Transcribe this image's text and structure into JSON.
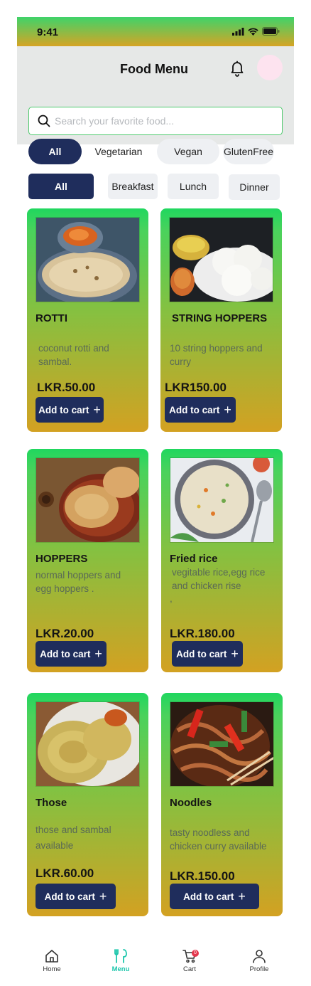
{
  "status": {
    "time": "9:41"
  },
  "header": {
    "title": "Food Menu"
  },
  "search": {
    "placeholder": "Search your favorite food..."
  },
  "diet_filters": [
    {
      "label": "All",
      "active": true
    },
    {
      "label": "Vegetarian",
      "active": false
    },
    {
      "label": "Vegan",
      "active": false
    },
    {
      "label": "GlutenFree",
      "active": false
    }
  ],
  "meal_filters": [
    {
      "label": "All",
      "active": true
    },
    {
      "label": "Breakfast",
      "active": false
    },
    {
      "label": "Lunch",
      "active": false
    },
    {
      "label": "Dinner",
      "active": false
    }
  ],
  "items": [
    {
      "name": "ROTTI",
      "description": "coconut rotti and sambal.",
      "price": "LKR.50.00",
      "button": "Add to cart",
      "image": "rotti-photo"
    },
    {
      "name": "STRING HOPPERS",
      "description": "10 string hoppers and curry",
      "price": "LKR150.00",
      "button": "Add to cart",
      "image": "string-hoppers-photo"
    },
    {
      "name": "HOPPERS",
      "description": "normal hoppers and egg hoppers .",
      "price": "LKR.20.00",
      "button": "Add to cart",
      "image": "hoppers-photo"
    },
    {
      "name": "Fried rice",
      "description": "vegitable rice,egg rice and chicken rise",
      "description_extra": ",",
      "price": "LKR.180.00",
      "button": "Add to cart",
      "image": "fried-rice-photo"
    },
    {
      "name": "Those",
      "description": "those and sambal available",
      "price": "LKR.60.00",
      "button": "Add to cart",
      "image": "thosai-photo"
    },
    {
      "name": "Noodles",
      "description_extra": ".",
      "description": "tasty noodless and chicken curry available",
      "price": "LKR.150.00",
      "button": "Add to cart",
      "image": "noodles-photo"
    }
  ],
  "bottom_nav": [
    {
      "label": "Home",
      "icon": "home-icon"
    },
    {
      "label": "Menu",
      "icon": "menu-icon",
      "active": true
    },
    {
      "label": "Cart",
      "icon": "cart-icon",
      "badge": "0"
    },
    {
      "label": "Profile",
      "icon": "profile-icon"
    }
  ],
  "colors": {
    "primary": "#1f2d5c",
    "accent_green": "#20d75f",
    "accent_gold": "#d3a122",
    "nav_active": "#1ec6ac"
  }
}
